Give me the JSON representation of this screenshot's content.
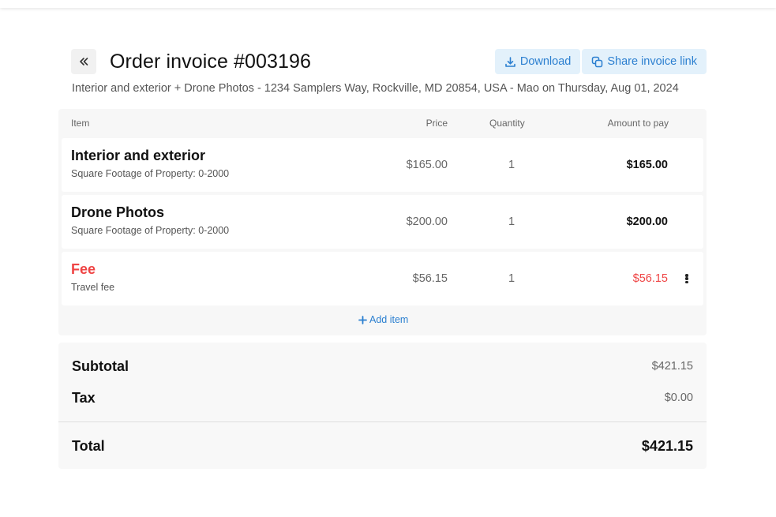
{
  "header": {
    "back_icon": "chevrons-left-icon",
    "title": "Order invoice #003196",
    "download_label": "Download",
    "download_icon": "download-icon",
    "share_label": "Share invoice link",
    "share_icon": "copy-link-icon",
    "subtitle": "Interior and exterior + Drone Photos - 1234 Samplers Way, Rockville, MD 20854, USA - Mao on Thursday, Aug 01, 2024"
  },
  "table": {
    "columns": {
      "item": "Item",
      "price": "Price",
      "quantity": "Quantity",
      "amount": "Amount to pay"
    },
    "rows": [
      {
        "name": "Interior and exterior",
        "description": "Square Footage of Property: 0-2000",
        "price": "$165.00",
        "quantity": "1",
        "amount": "$165.00"
      },
      {
        "name": "Drone Photos",
        "description": "Square Footage of Property: 0-2000",
        "price": "$200.00",
        "quantity": "1",
        "amount": "$200.00"
      },
      {
        "name": "Fee",
        "description": "Travel fee",
        "price": "$56.15",
        "quantity": "1",
        "amount": "$56.15"
      }
    ],
    "add_item_label": "Add item",
    "add_icon": "plus-icon",
    "more_icon": "more-vertical-icon"
  },
  "totals": {
    "subtotal_label": "Subtotal",
    "subtotal_value": "$421.15",
    "tax_label": "Tax",
    "tax_value": "$0.00",
    "total_label": "Total",
    "total_value": "$421.15"
  },
  "colors": {
    "accent": "#2b7fd0",
    "accent_bg": "#e3f1fb",
    "fee_red": "#ef4444"
  }
}
